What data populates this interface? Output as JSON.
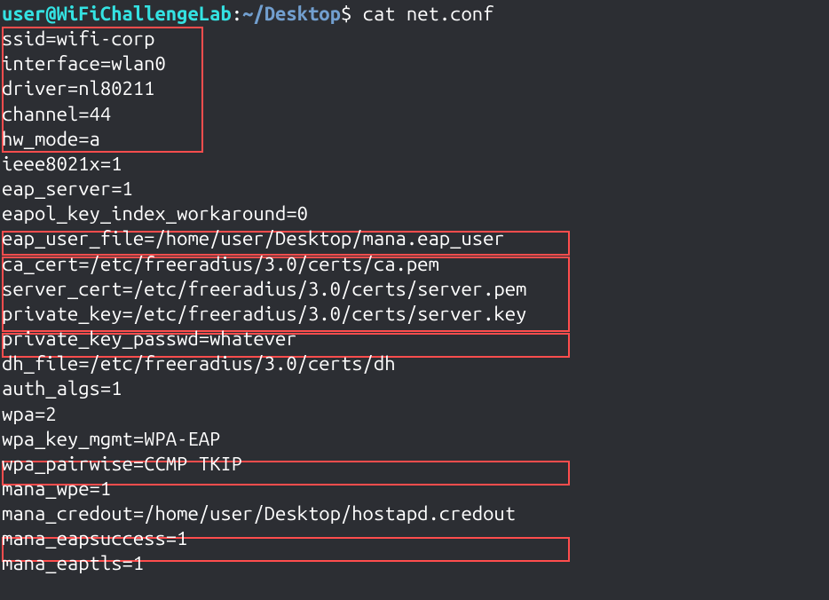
{
  "prompt": {
    "user": "user",
    "at": "@",
    "host": "WiFiChallengeLab",
    "colon": ":",
    "path": "~/Desktop",
    "dollar": "$ ",
    "command": "cat net.conf"
  },
  "config_lines": [
    "ssid=wifi-corp",
    "interface=wlan0",
    "driver=nl80211",
    "channel=44",
    "hw_mode=a",
    "ieee8021x=1",
    "eap_server=1",
    "eapol_key_index_workaround=0",
    "eap_user_file=/home/user/Desktop/mana.eap_user",
    "ca_cert=/etc/freeradius/3.0/certs/ca.pem",
    "server_cert=/etc/freeradius/3.0/certs/server.pem",
    "private_key=/etc/freeradius/3.0/certs/server.key",
    "private_key_passwd=whatever",
    "dh_file=/etc/freeradius/3.0/certs/dh",
    "auth_algs=1",
    "wpa=2",
    "wpa_key_mgmt=WPA-EAP",
    "wpa_pairwise=CCMP TKIP",
    "mana_wpe=1",
    "mana_credout=/home/user/Desktop/hostapd.credout",
    "mana_eapsuccess=1",
    "mana_eaptls=1"
  ]
}
